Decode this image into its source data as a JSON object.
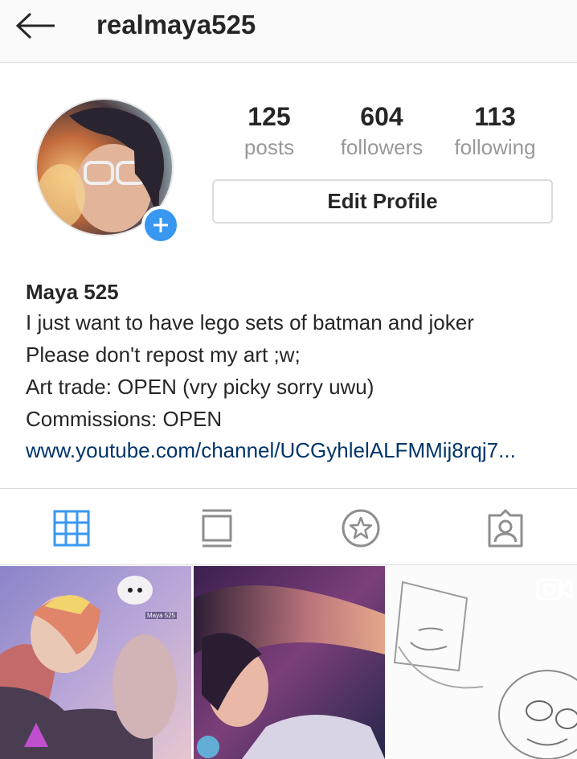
{
  "header": {
    "username": "realmaya525",
    "back_icon": "arrow-left-icon"
  },
  "profile": {
    "avatar_icon": "profile-avatar",
    "add_story_icon": "plus-icon",
    "stats": [
      {
        "value": "125",
        "label": "posts"
      },
      {
        "value": "604",
        "label": "followers"
      },
      {
        "value": "113",
        "label": "following"
      }
    ],
    "edit_button_label": "Edit Profile"
  },
  "bio": {
    "name": "Maya 525",
    "lines": [
      "I just want to have lego sets of batman and joker",
      "Please don't repost my art ;w;",
      "Art trade: OPEN (vry picky sorry uwu)",
      "Commissions: OPEN"
    ],
    "link": "www.youtube.com/channel/UCGyhlelALFMMij8rqj7..."
  },
  "tabs": [
    {
      "icon": "grid-icon",
      "active": true
    },
    {
      "icon": "feed-icon",
      "active": false
    },
    {
      "icon": "star-icon",
      "active": false
    },
    {
      "icon": "tagged-person-icon",
      "active": false
    }
  ],
  "posts": [
    {
      "thumb": "post-thumbnail-1",
      "watermark": "Maya 525"
    },
    {
      "thumb": "post-thumbnail-2"
    },
    {
      "thumb": "post-thumbnail-3",
      "badge": "video-icon"
    }
  ],
  "colors": {
    "accent": "#3897f0",
    "link": "#003569",
    "muted": "#999999",
    "border": "#dbdbdb",
    "header_bg": "#fafafa"
  }
}
